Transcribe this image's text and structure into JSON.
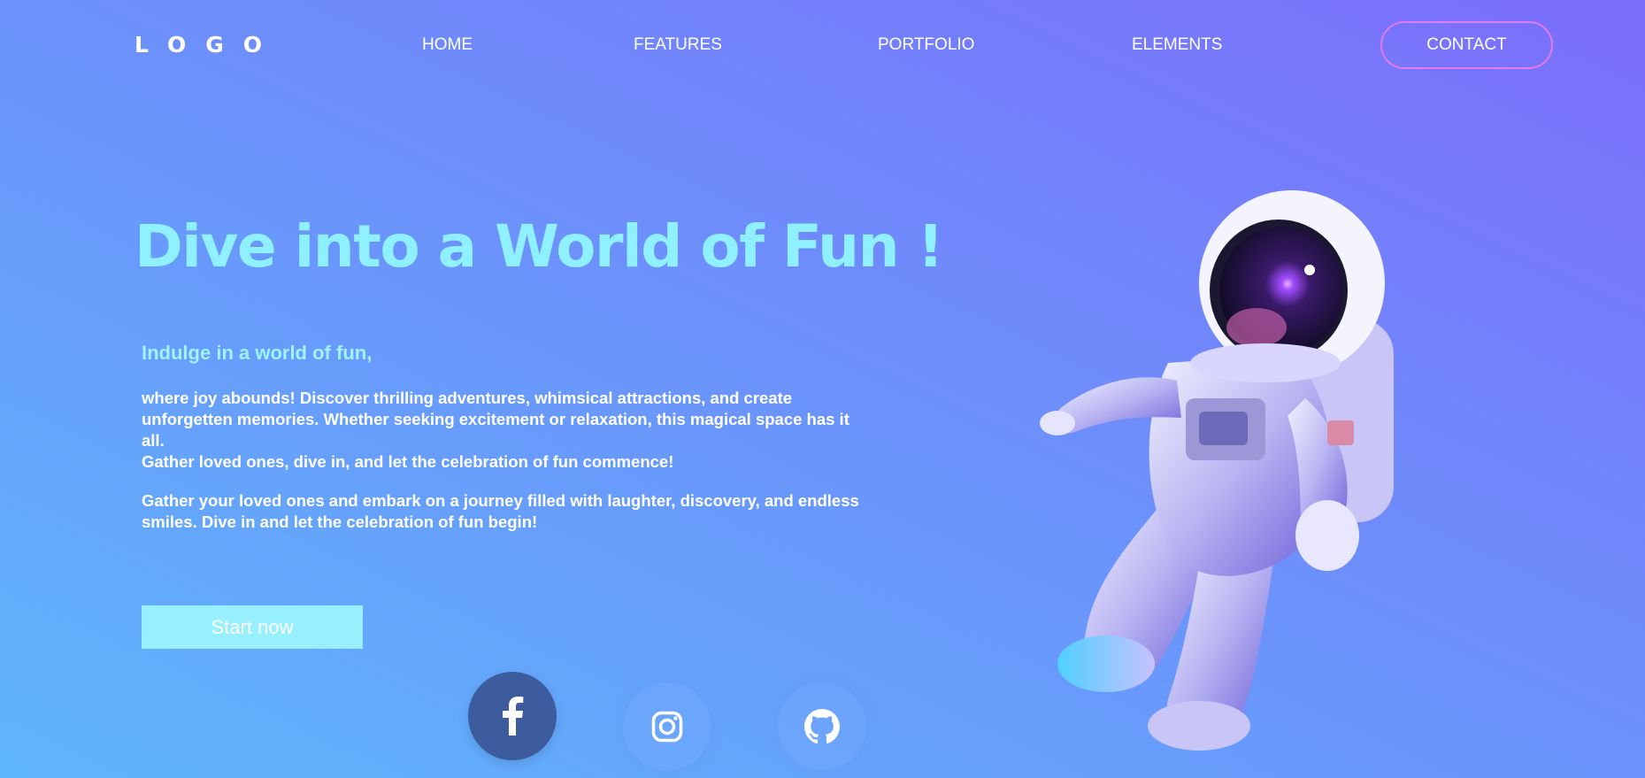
{
  "header": {
    "logo": "LOGO",
    "nav": {
      "home": "HOME",
      "features": "FEATURES",
      "portfolio": "PORTFOLIO",
      "elements": "ELEMENTS"
    },
    "contact_label": "CONTACT"
  },
  "hero": {
    "title": "Dive into a World of Fun !",
    "subheading": "Indulge in a world of fun,",
    "paragraph1_line1": "where joy abounds! Discover thrilling adventures, whimsical attractions, and create unforgetten memories. Whether seeking excitement or relaxation, this magical space has it all.",
    "paragraph1_line2": "Gather loved ones, dive in, and let the celebration of fun commence!",
    "paragraph2": "Gather your loved ones and embark on a journey filled with laughter, discovery, and endless smiles. Dive in and let the celebration of fun begin!",
    "cta_label": "Start now"
  },
  "social": [
    "facebook-icon",
    "instagram-icon",
    "github-icon"
  ],
  "colors": {
    "title": "#8ff0ff",
    "cta_bg": "#98effd",
    "contact_border": "#e07bf2",
    "facebook_bg": "#3d5c9e",
    "gradient_start": "#5fb6fb",
    "gradient_end": "#7c6dfb"
  }
}
